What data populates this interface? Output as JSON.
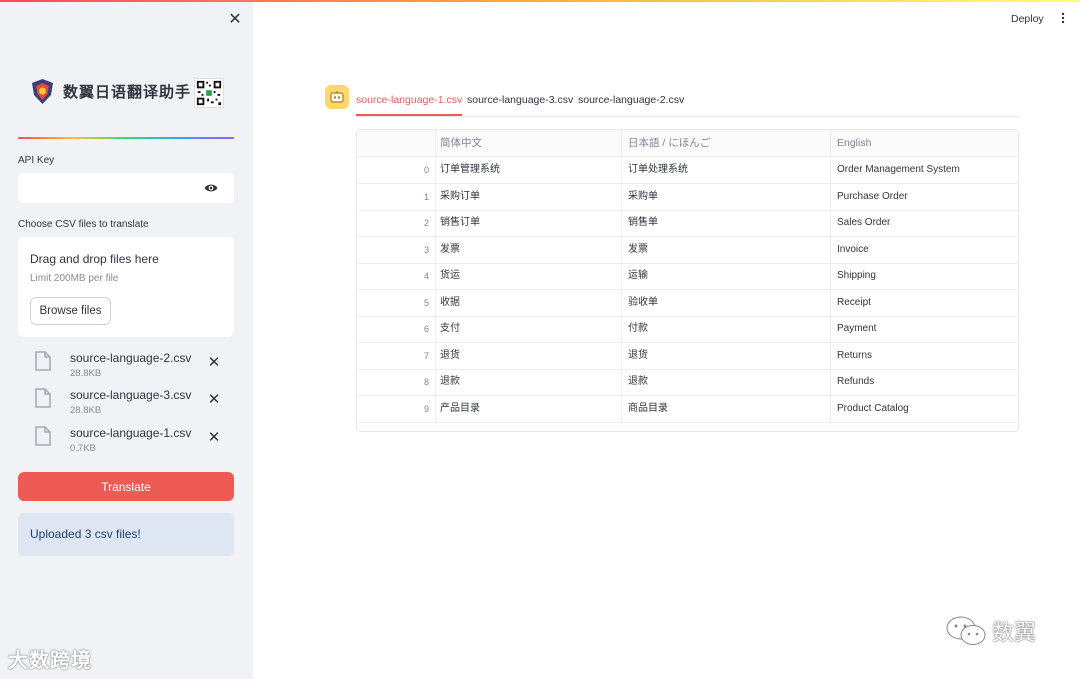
{
  "sidebar": {
    "brand_title": "数翼日语翻译助手",
    "api_key_label": "API Key",
    "api_key_value": "",
    "csv_label": "Choose CSV files to translate",
    "uploader": {
      "drag_text": "Drag and drop files here",
      "limit_text": "Limit 200MB per file",
      "browse_label": "Browse files"
    },
    "files": [
      {
        "name": "source-language-2.csv",
        "size": "28.8KB"
      },
      {
        "name": "source-language-3.csv",
        "size": "28.8KB"
      },
      {
        "name": "source-language-1.csv",
        "size": "0.7KB"
      }
    ],
    "translate_label": "Translate",
    "alert_text": "Uploaded 3 csv files!",
    "watermark": "大数跨境"
  },
  "header": {
    "deploy_label": "Deploy"
  },
  "main": {
    "tabs": [
      {
        "label": "source-language-1.csv",
        "active": true
      },
      {
        "label": "source-language-3.csv",
        "active": false
      },
      {
        "label": "source-language-2.csv",
        "active": false
      }
    ],
    "table": {
      "columns": [
        "",
        "简体中文",
        "日本語 / にほんご",
        "English"
      ],
      "rows": [
        {
          "index": "0",
          "zh": "订单管理系统",
          "ja": "订单处理系统",
          "en": "Order Management System"
        },
        {
          "index": "1",
          "zh": "采购订单",
          "ja": "采购单",
          "en": "Purchase Order"
        },
        {
          "index": "2",
          "zh": "销售订单",
          "ja": "销售单",
          "en": "Sales Order"
        },
        {
          "index": "3",
          "zh": "发票",
          "ja": "发票",
          "en": "Invoice"
        },
        {
          "index": "4",
          "zh": "货运",
          "ja": "运输",
          "en": "Shipping"
        },
        {
          "index": "5",
          "zh": "收据",
          "ja": "验收单",
          "en": "Receipt"
        },
        {
          "index": "6",
          "zh": "支付",
          "ja": "付款",
          "en": "Payment"
        },
        {
          "index": "7",
          "zh": "退货",
          "ja": "退货",
          "en": "Returns"
        },
        {
          "index": "8",
          "zh": "退款",
          "ja": "退款",
          "en": "Refunds"
        },
        {
          "index": "9",
          "zh": "产品目录",
          "ja": "商品目录",
          "en": "Product Catalog"
        }
      ]
    }
  },
  "watermark_right": "数翼",
  "colors": {
    "primary": "#f05a55",
    "sidebar_bg": "#f0f2f6",
    "alert_bg": "#dde6f2",
    "alert_text": "#1e3f73",
    "tab_icon_bg": "#ffd770"
  }
}
